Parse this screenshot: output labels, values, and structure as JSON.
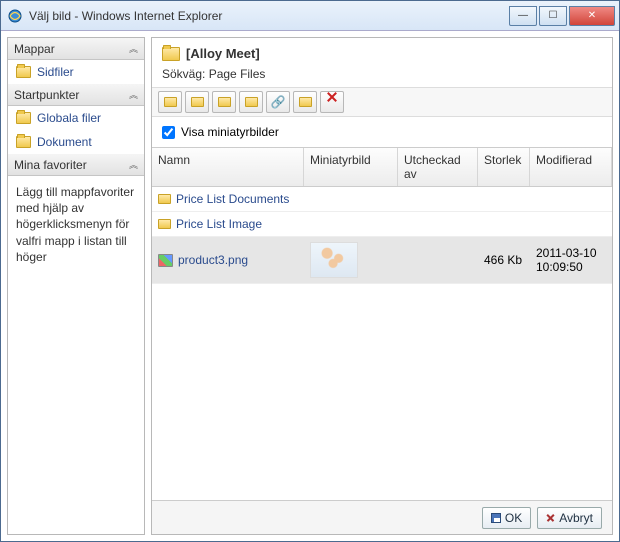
{
  "titlebar": {
    "text": "Välj bild - Windows Internet Explorer"
  },
  "sidebar": {
    "sections": [
      {
        "label": "Mappar",
        "items": [
          {
            "label": "Sidfiler"
          }
        ]
      },
      {
        "label": "Startpunkter",
        "items": [
          {
            "label": "Globala filer"
          },
          {
            "label": "Dokument"
          }
        ]
      },
      {
        "label": "Mina favoriter",
        "help": "Lägg till mappfavoriter med hjälp av högerklicksmenyn för valfri mapp i listan till höger"
      }
    ]
  },
  "main": {
    "title": "[Alloy Meet]",
    "path_label": "Sökväg:",
    "path_value": "Page Files",
    "thumb_checkbox_label": "Visa miniatyrbilder",
    "thumb_checked": true,
    "columns": {
      "name": "Namn",
      "thumb": "Miniatyrbild",
      "checkedout": "Utcheckad av",
      "size": "Storlek",
      "modified": "Modifierad"
    },
    "rows": [
      {
        "type": "folder",
        "name": "Price List Documents"
      },
      {
        "type": "folder",
        "name": "Price List Image"
      },
      {
        "type": "file",
        "name": "product3.png",
        "size": "466 Kb",
        "modified": "2011-03-10 10:09:50",
        "selected": true
      }
    ]
  },
  "footer": {
    "ok": "OK",
    "cancel": "Avbryt"
  }
}
